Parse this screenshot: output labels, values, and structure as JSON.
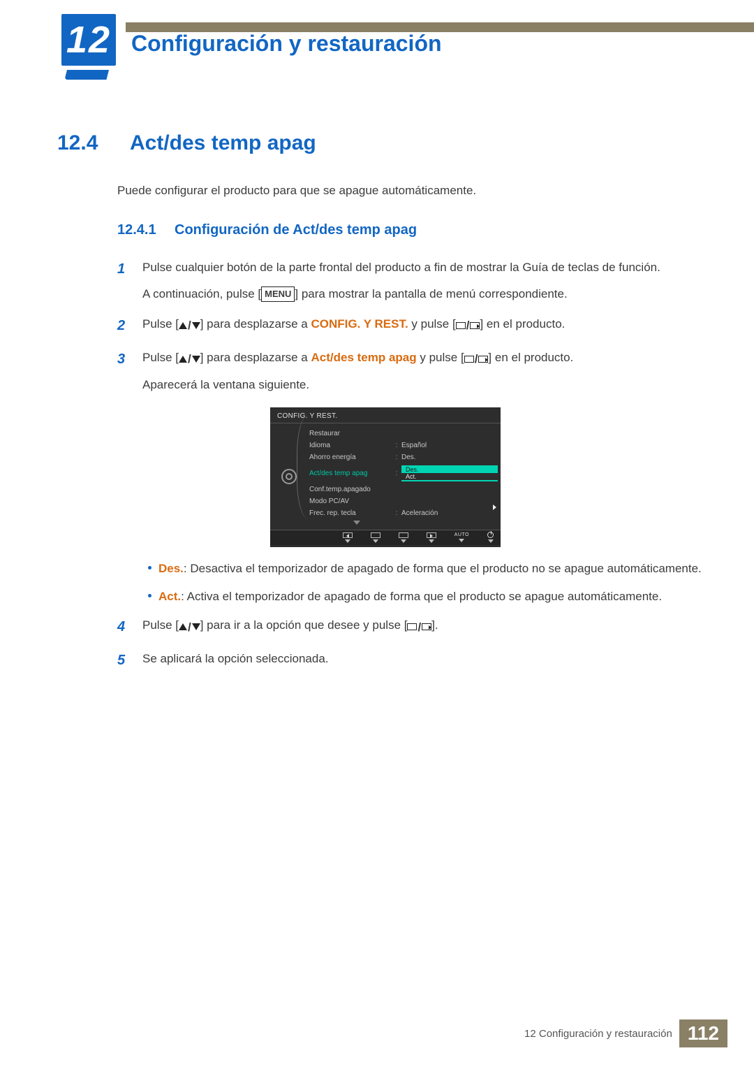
{
  "chapter": {
    "num": "12",
    "title": "Configuración y restauración"
  },
  "section": {
    "num": "12.4",
    "title": "Act/des temp apag"
  },
  "intro": "Puede configurar el producto para que se apague automáticamente.",
  "subsection": {
    "num": "12.4.1",
    "title": "Configuración de Act/des temp apag"
  },
  "steps": {
    "s1": {
      "n": "1",
      "text": "Pulse cualquier botón de la parte frontal del producto a fin de mostrar la Guía de teclas de función.",
      "cont_a": "A continuación, pulse [",
      "menu": "MENU",
      "cont_b": "] para mostrar la pantalla de menú correspondiente."
    },
    "s2": {
      "n": "2",
      "a": "Pulse [",
      "b": "] para desplazarse a ",
      "target": "CONFIG. Y REST.",
      "c": " y pulse [",
      "d": "] en el producto."
    },
    "s3": {
      "n": "3",
      "a": "Pulse [",
      "b": "] para desplazarse a ",
      "target": "Act/des temp apag",
      "c": " y pulse [",
      "d": "] en el producto.",
      "cont": "Aparecerá la ventana siguiente."
    },
    "s4": {
      "n": "4",
      "a": "Pulse [",
      "b": "] para ir a la opción que desee y pulse [",
      "c": "]."
    },
    "s5": {
      "n": "5",
      "text": "Se aplicará la opción seleccionada."
    }
  },
  "osd": {
    "title": "CONFIG. Y REST.",
    "items": {
      "restaurar": "Restaurar",
      "idioma": "Idioma",
      "idioma_val": "Español",
      "ahorro": "Ahorro energía",
      "ahorro_val": "Des.",
      "actdes": "Act/des temp apag",
      "opt_des": "Des.",
      "opt_act": "Act.",
      "conftemp": "Conf.temp.apagado",
      "modo": "Modo PC/AV",
      "frec": "Frec. rep. tecla",
      "frec_val": "Aceleración"
    },
    "footer_auto": "AUTO"
  },
  "bullets": {
    "des_label": "Des.",
    "des_text": ": Desactiva el temporizador de apagado de forma que el producto no se apague automáticamente.",
    "act_label": "Act.",
    "act_text": ": Activa el temporizador de apagado de forma que el producto se apague automáticamente."
  },
  "footer": {
    "text": "12 Configuración y restauración",
    "page": "112"
  }
}
